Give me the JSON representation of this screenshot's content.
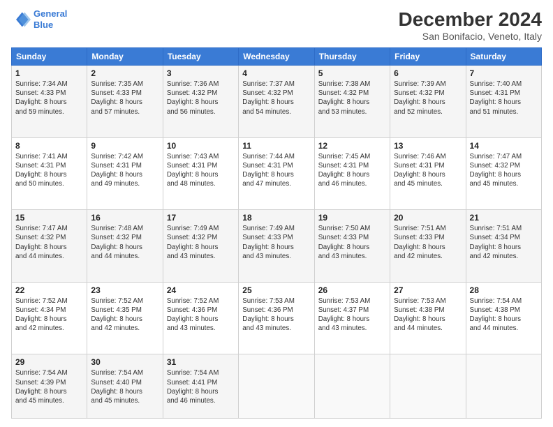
{
  "logo": {
    "line1": "General",
    "line2": "Blue"
  },
  "title": "December 2024",
  "subtitle": "San Bonifacio, Veneto, Italy",
  "days_of_week": [
    "Sunday",
    "Monday",
    "Tuesday",
    "Wednesday",
    "Thursday",
    "Friday",
    "Saturday"
  ],
  "weeks": [
    [
      {
        "day": "1",
        "sunrise": "7:34 AM",
        "sunset": "4:33 PM",
        "daylight_h": "8",
        "daylight_m": "59"
      },
      {
        "day": "2",
        "sunrise": "7:35 AM",
        "sunset": "4:33 PM",
        "daylight_h": "8",
        "daylight_m": "57"
      },
      {
        "day": "3",
        "sunrise": "7:36 AM",
        "sunset": "4:32 PM",
        "daylight_h": "8",
        "daylight_m": "56"
      },
      {
        "day": "4",
        "sunrise": "7:37 AM",
        "sunset": "4:32 PM",
        "daylight_h": "8",
        "daylight_m": "54"
      },
      {
        "day": "5",
        "sunrise": "7:38 AM",
        "sunset": "4:32 PM",
        "daylight_h": "8",
        "daylight_m": "53"
      },
      {
        "day": "6",
        "sunrise": "7:39 AM",
        "sunset": "4:32 PM",
        "daylight_h": "8",
        "daylight_m": "52"
      },
      {
        "day": "7",
        "sunrise": "7:40 AM",
        "sunset": "4:31 PM",
        "daylight_h": "8",
        "daylight_m": "51"
      }
    ],
    [
      {
        "day": "8",
        "sunrise": "7:41 AM",
        "sunset": "4:31 PM",
        "daylight_h": "8",
        "daylight_m": "50"
      },
      {
        "day": "9",
        "sunrise": "7:42 AM",
        "sunset": "4:31 PM",
        "daylight_h": "8",
        "daylight_m": "49"
      },
      {
        "day": "10",
        "sunrise": "7:43 AM",
        "sunset": "4:31 PM",
        "daylight_h": "8",
        "daylight_m": "48"
      },
      {
        "day": "11",
        "sunrise": "7:44 AM",
        "sunset": "4:31 PM",
        "daylight_h": "8",
        "daylight_m": "47"
      },
      {
        "day": "12",
        "sunrise": "7:45 AM",
        "sunset": "4:31 PM",
        "daylight_h": "8",
        "daylight_m": "46"
      },
      {
        "day": "13",
        "sunrise": "7:46 AM",
        "sunset": "4:31 PM",
        "daylight_h": "8",
        "daylight_m": "45"
      },
      {
        "day": "14",
        "sunrise": "7:47 AM",
        "sunset": "4:32 PM",
        "daylight_h": "8",
        "daylight_m": "45"
      }
    ],
    [
      {
        "day": "15",
        "sunrise": "7:47 AM",
        "sunset": "4:32 PM",
        "daylight_h": "8",
        "daylight_m": "44"
      },
      {
        "day": "16",
        "sunrise": "7:48 AM",
        "sunset": "4:32 PM",
        "daylight_h": "8",
        "daylight_m": "44"
      },
      {
        "day": "17",
        "sunrise": "7:49 AM",
        "sunset": "4:32 PM",
        "daylight_h": "8",
        "daylight_m": "43"
      },
      {
        "day": "18",
        "sunrise": "7:49 AM",
        "sunset": "4:33 PM",
        "daylight_h": "8",
        "daylight_m": "43"
      },
      {
        "day": "19",
        "sunrise": "7:50 AM",
        "sunset": "4:33 PM",
        "daylight_h": "8",
        "daylight_m": "43"
      },
      {
        "day": "20",
        "sunrise": "7:51 AM",
        "sunset": "4:33 PM",
        "daylight_h": "8",
        "daylight_m": "42"
      },
      {
        "day": "21",
        "sunrise": "7:51 AM",
        "sunset": "4:34 PM",
        "daylight_h": "8",
        "daylight_m": "42"
      }
    ],
    [
      {
        "day": "22",
        "sunrise": "7:52 AM",
        "sunset": "4:34 PM",
        "daylight_h": "8",
        "daylight_m": "42"
      },
      {
        "day": "23",
        "sunrise": "7:52 AM",
        "sunset": "4:35 PM",
        "daylight_h": "8",
        "daylight_m": "42"
      },
      {
        "day": "24",
        "sunrise": "7:52 AM",
        "sunset": "4:36 PM",
        "daylight_h": "8",
        "daylight_m": "43"
      },
      {
        "day": "25",
        "sunrise": "7:53 AM",
        "sunset": "4:36 PM",
        "daylight_h": "8",
        "daylight_m": "43"
      },
      {
        "day": "26",
        "sunrise": "7:53 AM",
        "sunset": "4:37 PM",
        "daylight_h": "8",
        "daylight_m": "43"
      },
      {
        "day": "27",
        "sunrise": "7:53 AM",
        "sunset": "4:38 PM",
        "daylight_h": "8",
        "daylight_m": "44"
      },
      {
        "day": "28",
        "sunrise": "7:54 AM",
        "sunset": "4:38 PM",
        "daylight_h": "8",
        "daylight_m": "44"
      }
    ],
    [
      {
        "day": "29",
        "sunrise": "7:54 AM",
        "sunset": "4:39 PM",
        "daylight_h": "8",
        "daylight_m": "45"
      },
      {
        "day": "30",
        "sunrise": "7:54 AM",
        "sunset": "4:40 PM",
        "daylight_h": "8",
        "daylight_m": "45"
      },
      {
        "day": "31",
        "sunrise": "7:54 AM",
        "sunset": "4:41 PM",
        "daylight_h": "8",
        "daylight_m": "46"
      },
      null,
      null,
      null,
      null
    ]
  ]
}
